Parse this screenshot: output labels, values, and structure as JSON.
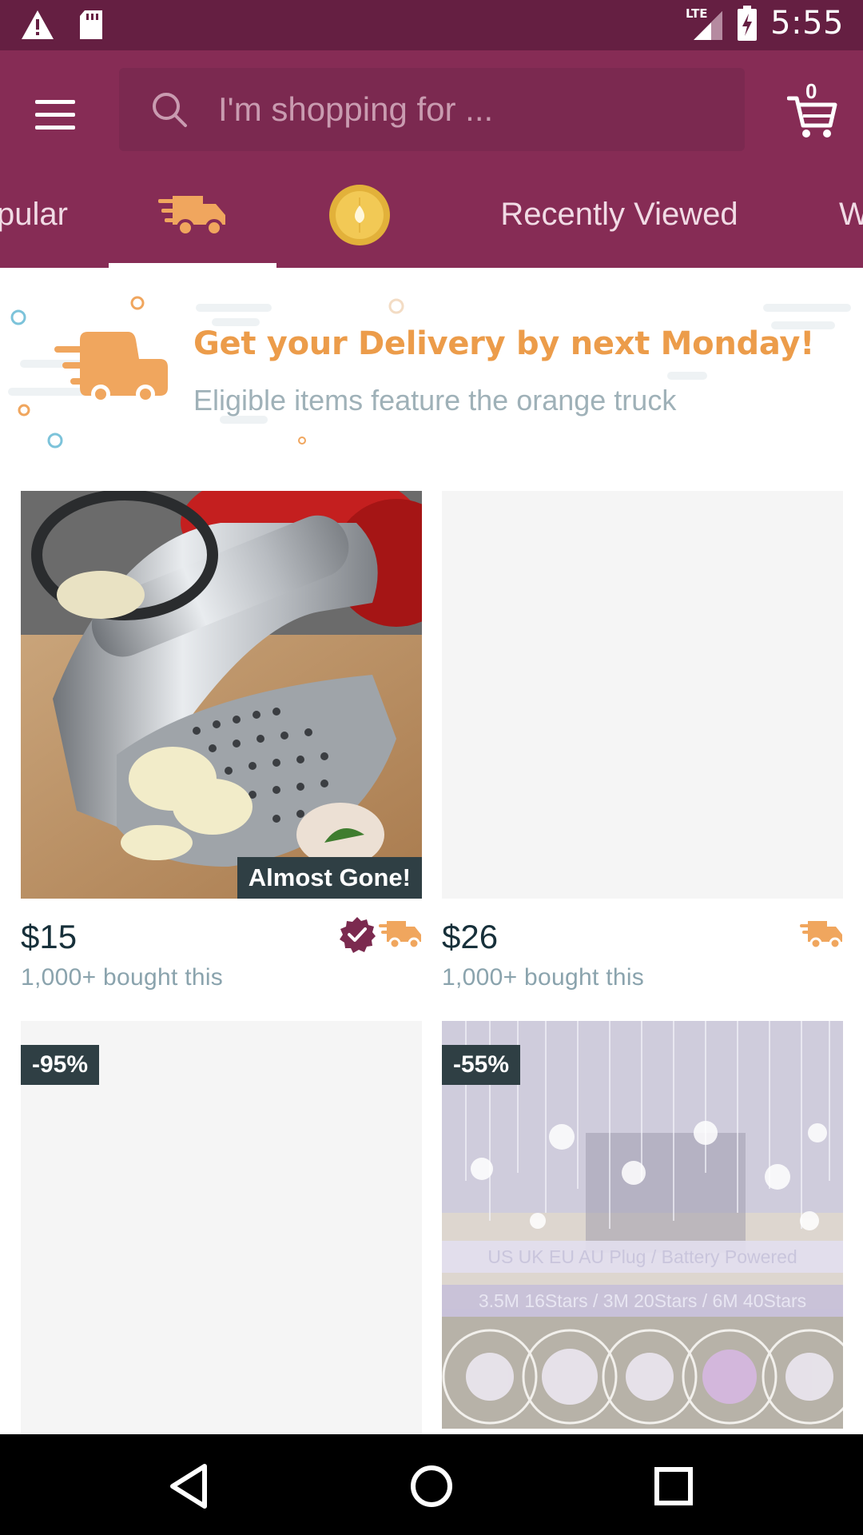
{
  "status_bar": {
    "time": "5:55",
    "network": "LTE",
    "icons": [
      "warning-icon",
      "sd-card-icon",
      "signal-icon",
      "battery-charging-icon"
    ]
  },
  "app_bar": {
    "search_placeholder": "I'm shopping for ...",
    "cart_count": "0"
  },
  "tabs": [
    {
      "label": "pular",
      "icon": null
    },
    {
      "label": "",
      "icon": "fast-delivery-truck-icon"
    },
    {
      "label": "",
      "icon": "coin-icon"
    },
    {
      "label": "Recently Viewed",
      "icon": null
    },
    {
      "label": "W",
      "icon": null
    }
  ],
  "banner": {
    "title": "Get your Delivery by next Monday!",
    "subtitle": "Eligible items feature the orange truck"
  },
  "products": [
    {
      "price": "$15",
      "bought": "1,000+ bought this",
      "badge": "Almost Gone!",
      "verified": true,
      "fast_delivery": true
    },
    {
      "price": "$26",
      "bought": "1,000+ bought this",
      "badge": "",
      "verified": false,
      "fast_delivery": true
    },
    {
      "discount": "-95%"
    },
    {
      "discount": "-55%",
      "image_text": [
        "US UK EU AU Plug  /  Battery Powered",
        "3.5M 16Stars / 3M 20Stars / 6M 40Stars"
      ]
    }
  ],
  "colors": {
    "status_bar": "#651f42",
    "app_bar": "#862c55",
    "accent_orange": "#ec9c4a",
    "badge_dark": "#2f3f44"
  }
}
